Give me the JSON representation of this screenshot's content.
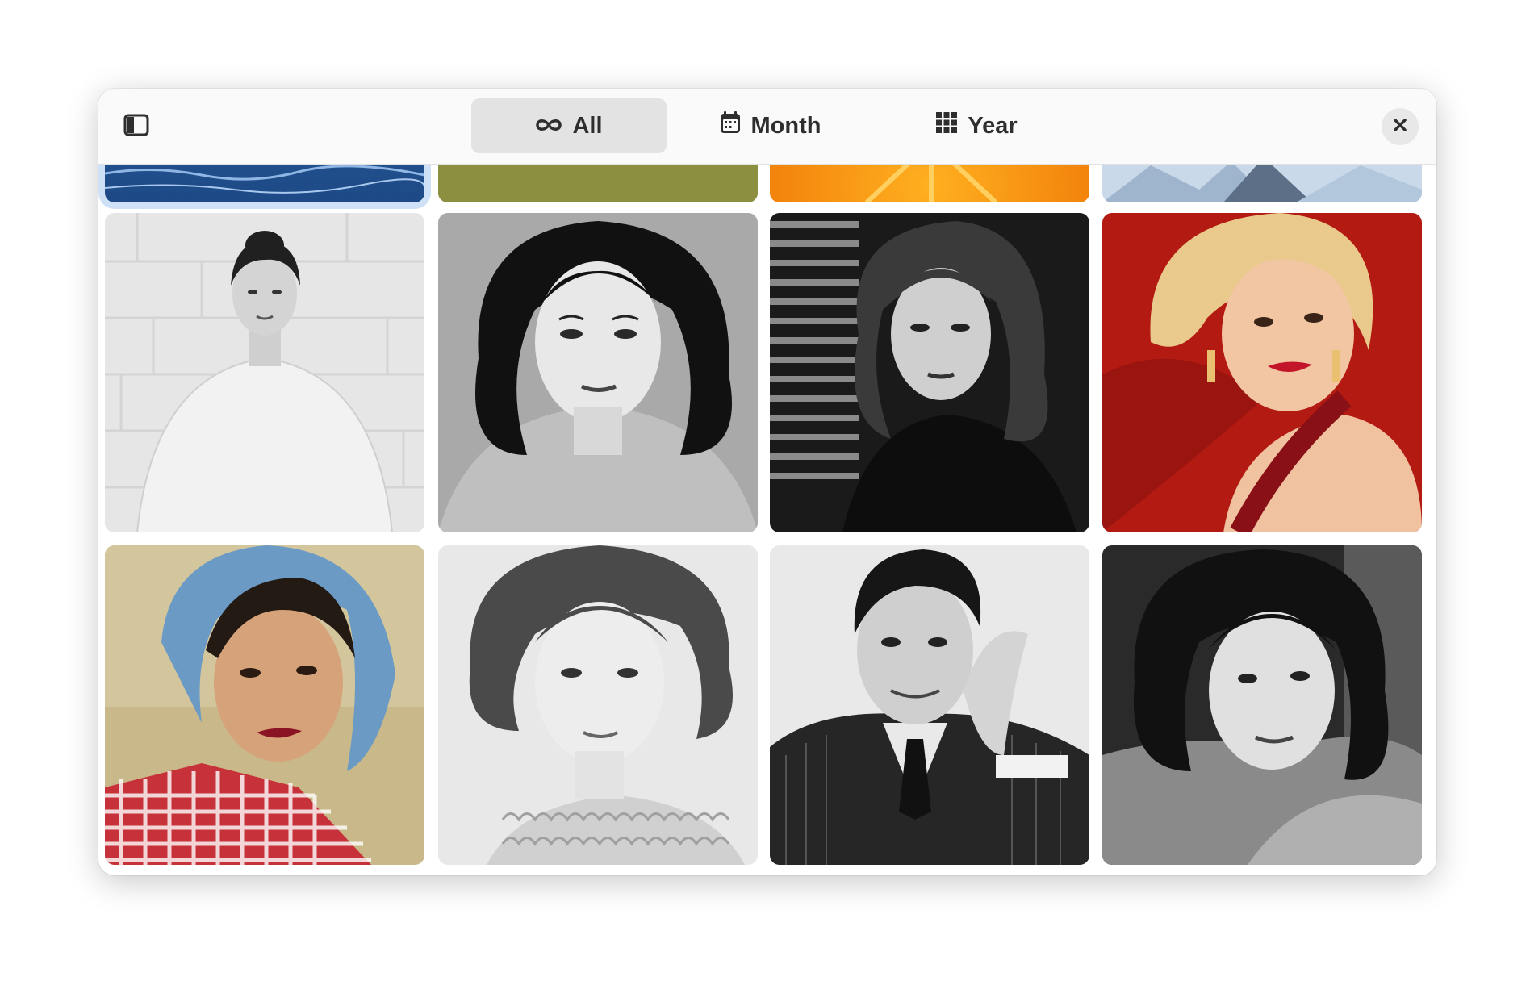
{
  "header": {
    "sidebar_toggle_icon": "sidebar-show-icon",
    "tabs": [
      {
        "label": "All",
        "icon": "infinity-icon",
        "active": true
      },
      {
        "label": "Month",
        "icon": "calendar-icon",
        "active": false
      },
      {
        "label": "Year",
        "icon": "grid-icon",
        "active": false
      }
    ],
    "close_icon": "close-icon"
  },
  "gallery": {
    "top_row": [
      {
        "name": "ocean-water-photo",
        "selected": true
      },
      {
        "name": "grass-field-photo",
        "selected": false
      },
      {
        "name": "orange-flower-photo",
        "selected": false
      },
      {
        "name": "ice-mountain-photo",
        "selected": false
      }
    ],
    "row_1": [
      {
        "name": "bw-portrait-woman-white-top"
      },
      {
        "name": "bw-portrait-woman-dark-curls"
      },
      {
        "name": "bw-portrait-woman-shutters"
      },
      {
        "name": "color-portrait-blonde-red"
      }
    ],
    "row_2": [
      {
        "name": "color-portrait-woman-blue-hat"
      },
      {
        "name": "bw-portrait-woman-lace"
      },
      {
        "name": "bw-portrait-man-suit"
      },
      {
        "name": "bw-portrait-woman-coat"
      }
    ]
  },
  "colors": {
    "selection_ring": "#cfe1f7",
    "active_tab_bg": "#e3e3e3",
    "header_bg": "#fafafa"
  }
}
